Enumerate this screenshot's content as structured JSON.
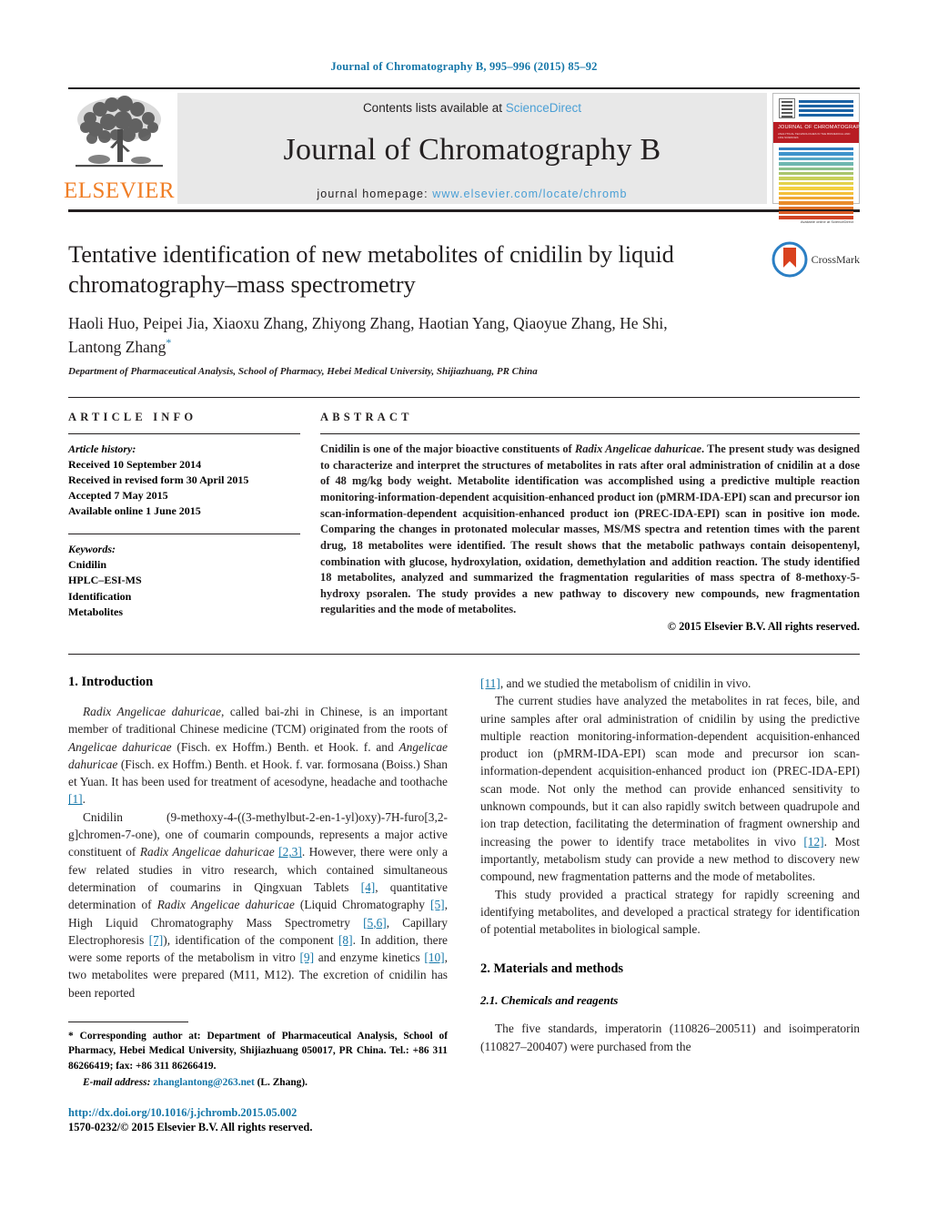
{
  "running_head": "Journal of Chromatography B, 995–996 (2015) 85–92",
  "masthead": {
    "publisher_name": "ELSEVIER",
    "contents_prefix": "Contents lists available at ",
    "contents_link": "ScienceDirect",
    "journal_title": "Journal of Chromatography B",
    "homepage_prefix": "journal homepage:",
    "homepage_url": "www.elsevier.com/locate/chromb",
    "cover": {
      "red_band_title": "JOURNAL OF CHROMATOGRAPHY B",
      "red_band_sub": "ANALYTICAL TECHNOLOGIES IN THE BIOMEDICAL AND LIFE SCIENCES",
      "footer": "Available online at ScienceDirect"
    }
  },
  "article": {
    "title": "Tentative identification of new metabolites of cnidilin by liquid chromatography–mass spectrometry",
    "authors": "Haoli Huo, Peipei Jia, Xiaoxu Zhang, Zhiyong Zhang, Haotian Yang, Qiaoyue Zhang, He Shi, Lantong Zhang",
    "corresponding_marker": "*",
    "affiliation": "Department of Pharmaceutical Analysis, School of Pharmacy, Hebei Medical University, Shijiazhuang, PR China",
    "crossmark_label": "CrossMark"
  },
  "article_info": {
    "heading": "ARTICLE INFO",
    "history_label": "Article history:",
    "history": [
      "Received 10 September 2014",
      "Received in revised form 30 April 2015",
      "Accepted 7 May 2015",
      "Available online 1 June 2015"
    ],
    "keywords_label": "Keywords:",
    "keywords": [
      "Cnidilin",
      "HPLC–ESI-MS",
      "Identification",
      "Metabolites"
    ]
  },
  "abstract": {
    "heading": "ABSTRACT",
    "p1_a": "Cnidilin is one of the major bioactive constituents of ",
    "p1_italic": "Radix Angelicae dahuricae",
    "p1_b": ". The present study was designed to characterize and interpret the structures of metabolites in rats after oral administration of cnidilin at a dose of 48 mg/kg body weight. Metabolite identification was accomplished using a predictive multiple reaction monitoring-information-dependent acquisition-enhanced product ion (pMRM-IDA-EPI) scan and precursor ion scan-information-dependent acquisition-enhanced product ion (PREC-IDA-EPI) scan in positive ion mode. Comparing the changes in protonated molecular masses, MS/MS spectra and retention times with the parent drug, 18 metabolites were identified. The result shows that the metabolic pathways contain deisopentenyl, combination with glucose, hydroxylation, oxidation, demethylation and addition reaction. The study identified 18 metabolites, analyzed and summarized the fragmentation regularities of mass spectra of 8-methoxy-5-hydroxy psoralen. The study provides a new pathway to discovery new compounds, new fragmentation regularities and the mode of metabolites.",
    "copyright": "© 2015 Elsevier B.V. All rights reserved."
  },
  "sections": {
    "introduction_heading": "1. Introduction",
    "materials_heading": "2. Materials and methods",
    "chemicals_heading": "2.1. Chemicals and reagents"
  },
  "intro": {
    "p1": {
      "i1": "Radix Angelicae dahuricae",
      "t1": ", called bai-zhi in Chinese, is an important member of traditional Chinese medicine (TCM) originated from the roots of ",
      "i2": "Angelicae dahuricae",
      "t2": " (Fisch. ex Hoffm.) Benth. et Hook. f. and ",
      "i3": "Angelicae dahuricae",
      "t3": " (Fisch. ex Hoffm.) Benth. et Hook. f. var. formosana (Boiss.) Shan et Yuan. It has been used for treatment of acesodyne, headache and toothache ",
      "r1": "[1]",
      "t4": "."
    },
    "p2": {
      "t1": "Cnidilin (9-methoxy-4-((3-methylbut-2-en-1-yl)oxy)-7H-furo[3,2-g]chromen-7-one), one of coumarin compounds, represents a major active constituent of ",
      "i1": "Radix Angelicae dahuricae",
      "t2": " ",
      "r1": "[2,3]",
      "t3": ". However, there were only a few related studies in vitro research, which contained simultaneous determination of coumarins in Qingxuan Tablets ",
      "r2": "[4]",
      "t4": ", quantitative determination of ",
      "i2": "Radix Angelicae dahuricae",
      "t5": " (Liquid Chromatography ",
      "r3": "[5]",
      "t6": ", High Liquid Chromatography Mass Spectrometry ",
      "r4": "[5,6]",
      "t7": ", Capillary Electrophoresis ",
      "r5": "[7]",
      "t8": "), identification of the component ",
      "r6": "[8]",
      "t9": ". In addition, there were some reports of the metabolism in vitro ",
      "r7": "[9]",
      "t10": " and enzyme kinetics ",
      "r8": "[10]",
      "t11": ", two metabolites were prepared (M11, M12). The excretion of cnidilin has been reported ",
      "r9": "[11]",
      "t12": ", and we studied the metabolism of cnidilin in vivo."
    },
    "p3": {
      "t1": "The current studies have analyzed the metabolites in rat feces, bile, and urine samples after oral administration of cnidilin by using the predictive multiple reaction monitoring-information-dependent acquisition-enhanced product ion (pMRM-IDA-EPI) scan mode and precursor ion scan-information-dependent acquisition-enhanced product ion (PREC-IDA-EPI) scan mode. Not only the method can provide enhanced sensitivity to unknown compounds, but it can also rapidly switch between quadrupole and ion trap detection, facilitating the determination of fragment ownership and increasing the power to identify trace metabolites in vivo ",
      "r1": "[12]",
      "t2": ". Most importantly, metabolism study can provide a new method to discovery new compound, new fragmentation patterns and the mode of metabolites."
    },
    "p4": "This study provided a practical strategy for rapidly screening and identifying metabolites, and developed a practical strategy for identification of potential metabolites in biological sample."
  },
  "materials": {
    "p1": "The five standards, imperatorin (110826–200511) and isoimperatorin (110827–200407) were purchased from the"
  },
  "footnotes": {
    "corresponding": "* Corresponding author at: Department of Pharmaceutical Analysis, School of Pharmacy, Hebei Medical University, Shijiazhuang 050017, PR China. Tel.: +86 311 86266419; fax: +86 311 86266419.",
    "email_label": "E-mail address:",
    "email": "zhanglantong@263.net",
    "email_suffix": " (L. Zhang).",
    "doi": "http://dx.doi.org/10.1016/j.jchromb.2015.05.002",
    "issn": "1570-0232/© 2015 Elsevier B.V. All rights reserved."
  },
  "colors": {
    "link_blue": "#1476a8",
    "sciencedirect_blue": "#4a9fd5",
    "elsevier_orange": "#f07e26",
    "cover_red": "#b81d24"
  }
}
